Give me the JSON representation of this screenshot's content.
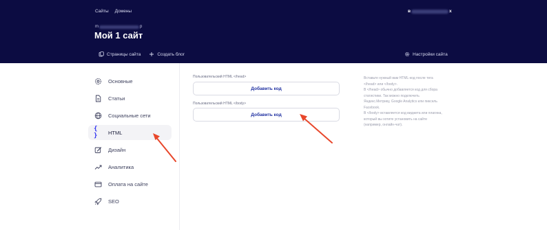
{
  "header": {
    "nav": [
      "Сайты",
      "Домены"
    ],
    "user_prefix": "в",
    "user_suffix": "х",
    "site_prefix": "m",
    "site_suffix": "p",
    "site_title": "Мой 1 сайт",
    "subnav": {
      "pages_label": "Страницы сайта",
      "create_blog_label": "Создать блог",
      "settings_label": "Настройки сайта"
    }
  },
  "sidebar": {
    "items": [
      {
        "label": "Основные",
        "icon": "gear-icon"
      },
      {
        "label": "Статьи",
        "icon": "document-icon"
      },
      {
        "label": "Социальные сети",
        "icon": "globe-icon"
      },
      {
        "label": "HTML",
        "icon": "braces-icon",
        "active": true
      },
      {
        "label": "Дизайн",
        "icon": "palette-icon"
      },
      {
        "label": "Аналитика",
        "icon": "trend-icon"
      },
      {
        "label": "Оплата на сайте",
        "icon": "card-icon"
      },
      {
        "label": "SEO",
        "icon": "rocket-icon"
      }
    ]
  },
  "main": {
    "head_label": "Пользовательский HTML </head>",
    "head_button": "Добавить код",
    "body_label": "Пользовательский HTML </body>",
    "body_button": "Добавить код"
  },
  "help": {
    "lines": [
      "Вставьте нужный вам HTML-код после тега",
      "</head> или </body>.",
      "В </head> обычно добавляется код для сбора",
      "статистики. Так можно подключить",
      "Яндекс.Метрику, Google Analytics или пиксель",
      "Facebook.",
      "В </body> вставляется код виджета или плагина,",
      "который вы хотите установить на сайте",
      "(например, онлайн-чат)."
    ]
  },
  "colors": {
    "header_bg": "#0c0c42",
    "accent": "#2a2df0",
    "arrow": "#e8472b"
  }
}
